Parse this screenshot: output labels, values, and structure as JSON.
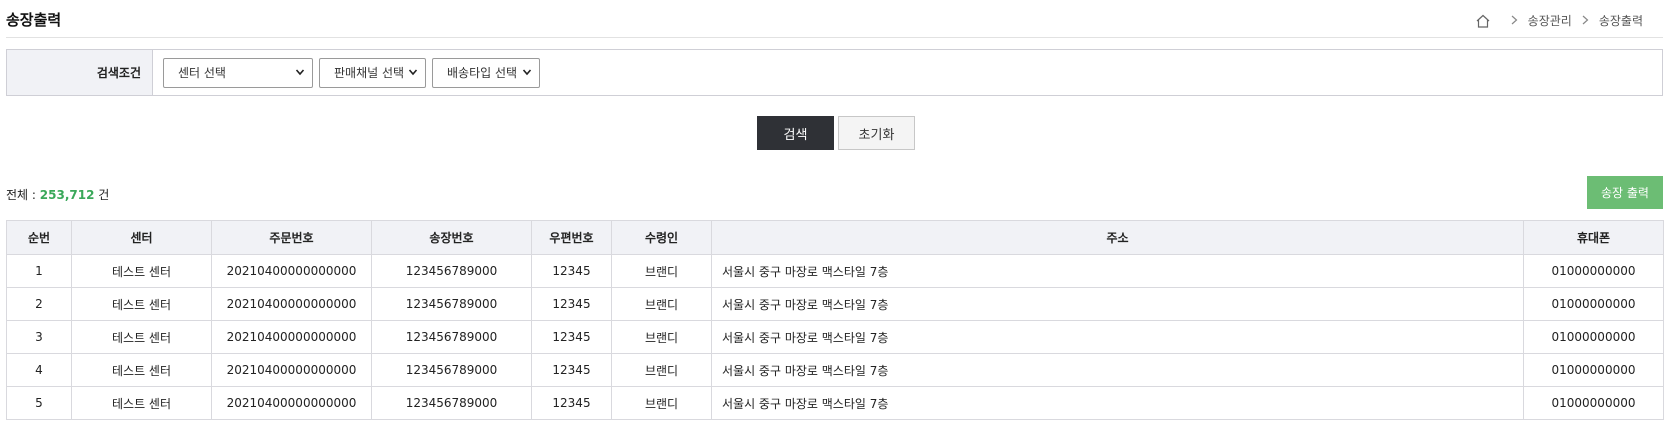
{
  "header": {
    "title": "송장출력",
    "breadcrumb": [
      "송장관리",
      "송장출력"
    ]
  },
  "search": {
    "label": "검색조건",
    "selects": [
      {
        "value": "센터 선택"
      },
      {
        "value": "판매채널 선택"
      },
      {
        "value": "배송타입 선택"
      }
    ],
    "search_button": "검색",
    "reset_button": "초기화"
  },
  "summary": {
    "prefix": "전체 :",
    "count": "253,712",
    "suffix": "건",
    "print_button": "송장 출력"
  },
  "table": {
    "columns": [
      "순번",
      "센터",
      "주문번호",
      "송장번호",
      "우편번호",
      "수령인",
      "주소",
      "휴대폰"
    ],
    "rows": [
      [
        "1",
        "테스트 센터",
        "20210400000000000",
        "123456789000",
        "12345",
        "브랜디",
        "서울시 중구 마장로 맥스타일 7층",
        "01000000000"
      ],
      [
        "2",
        "테스트 센터",
        "20210400000000000",
        "123456789000",
        "12345",
        "브랜디",
        "서울시 중구 마장로 맥스타일 7층",
        "01000000000"
      ],
      [
        "3",
        "테스트 센터",
        "20210400000000000",
        "123456789000",
        "12345",
        "브랜디",
        "서울시 중구 마장로 맥스타일 7층",
        "01000000000"
      ],
      [
        "4",
        "테스트 센터",
        "20210400000000000",
        "123456789000",
        "12345",
        "브랜디",
        "서울시 중구 마장로 맥스타일 7층",
        "01000000000"
      ],
      [
        "5",
        "테스트 센터",
        "20210400000000000",
        "123456789000",
        "12345",
        "브랜디",
        "서울시 중구 마장로 맥스타일 7층",
        "01000000000"
      ]
    ]
  },
  "colors": {
    "accent_green": "#3aa85a",
    "print_button": "#6cbd74",
    "search_button": "#2f3136",
    "header_bg": "#f1f2f6"
  },
  "icons": {
    "home": "home-icon",
    "breadcrumb_sep": "chevron-right-icon",
    "select_arrow": "chevron-down-icon"
  }
}
